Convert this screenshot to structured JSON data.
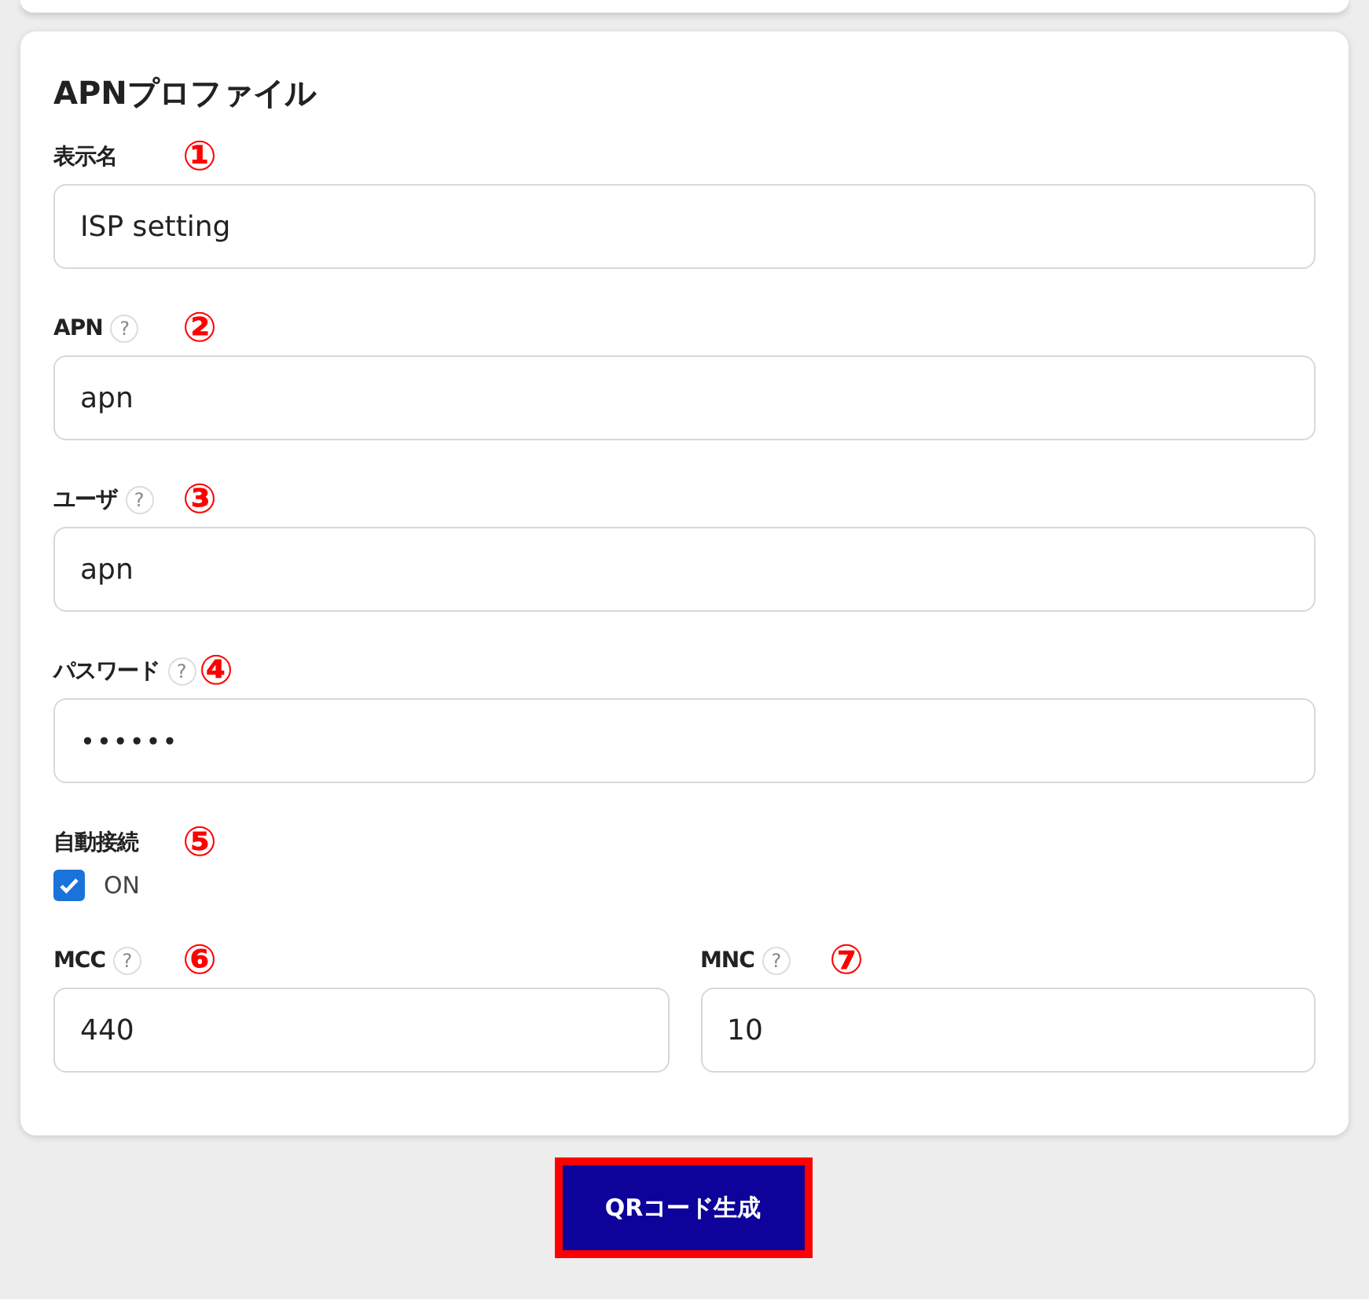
{
  "card": {
    "title": "APNプロファイル",
    "fields": [
      {
        "kind": "text",
        "label": "表示名",
        "annotation": "①",
        "value": "ISP setting"
      },
      {
        "kind": "text",
        "label": "APN",
        "help": "?",
        "annotation": "②",
        "value": "apn"
      },
      {
        "kind": "text",
        "label": "ユーザ",
        "help": "?",
        "annotation": "③",
        "value": "apn"
      },
      {
        "kind": "password",
        "label": "パスワード",
        "help": "?",
        "annotation": "④",
        "value": "••••••"
      },
      {
        "kind": "checkbox",
        "label": "自動接続",
        "annotation": "⑤",
        "option": "ON",
        "checked": true
      }
    ],
    "pair": [
      {
        "kind": "text",
        "label": "MCC",
        "help": "?",
        "annotation": "⑥",
        "value": "440"
      },
      {
        "kind": "text",
        "label": "MNC",
        "help": "?",
        "annotation": "⑦",
        "value": "10"
      }
    ]
  },
  "button": {
    "label": "QRコード生成",
    "annotation_frame": true
  }
}
